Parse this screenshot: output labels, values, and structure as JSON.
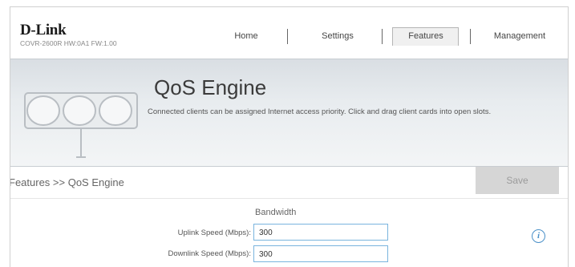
{
  "brand": {
    "logo": "D-Link",
    "model": "COVR-2600R HW:0A1 FW:1.00"
  },
  "nav": {
    "items": [
      {
        "label": "Home"
      },
      {
        "label": "Settings"
      },
      {
        "label": "Features"
      },
      {
        "label": "Management"
      }
    ],
    "active": "Features"
  },
  "banner": {
    "title": "QoS Engine",
    "description": "Connected clients can be assigned Internet access priority. Click and drag client cards into open slots."
  },
  "breadcrumb": "Features >> QoS Engine",
  "toolbar": {
    "save_label": "Save"
  },
  "bandwidth": {
    "title": "Bandwidth",
    "uplink_label": "Uplink Speed (Mbps):",
    "uplink_value": "300",
    "downlink_label": "Downlink Speed (Mbps):",
    "downlink_value": "300"
  },
  "icons": {
    "info": "info-icon",
    "banner": "qos-lights-icon"
  },
  "colors": {
    "accent": "#4a90c8",
    "save_disabled": "#d6d6d6"
  }
}
